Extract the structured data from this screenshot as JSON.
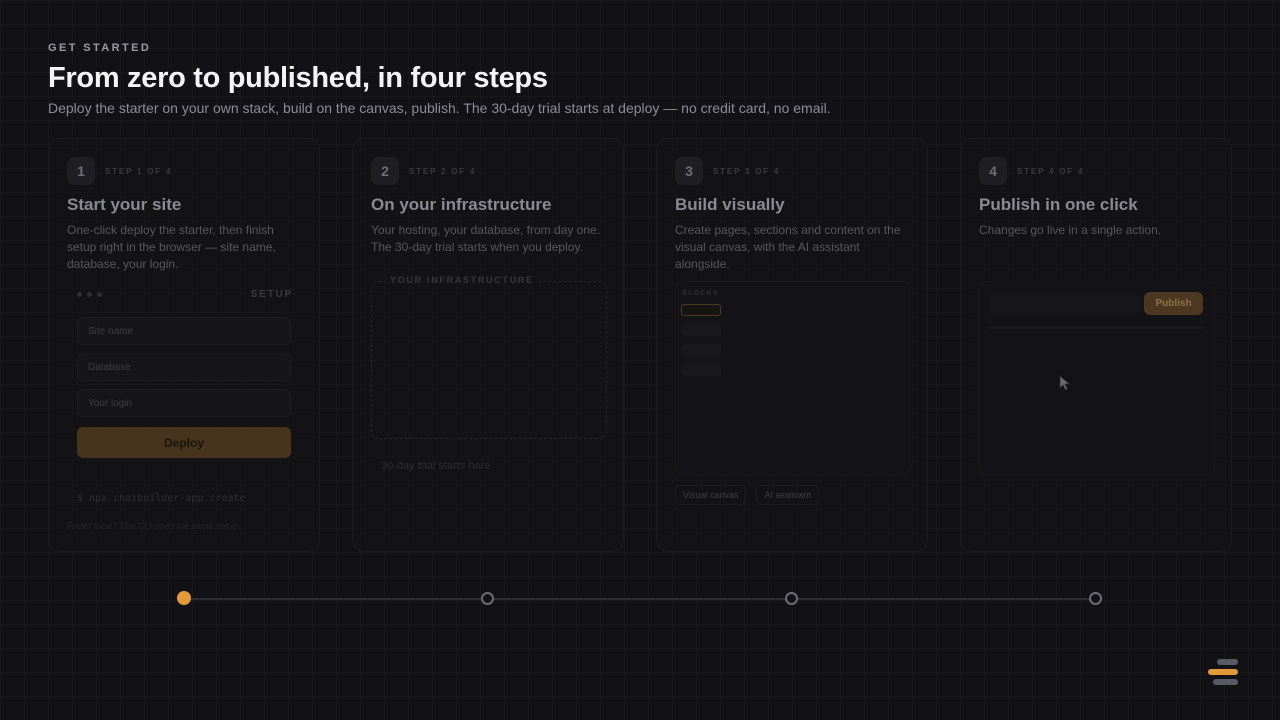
{
  "header": {
    "eyebrow": "GET STARTED",
    "title": "From zero to published, in four steps",
    "subtitle": "Deploy the starter on your own stack, build on the canvas, publish. The 30-day trial starts at deploy — no credit card, no email."
  },
  "steps": [
    {
      "number": "1",
      "label": "STEP 1 OF 4",
      "title": "Start your site",
      "description": "One-click deploy the starter, then finish setup right in the browser — site name, database, your login.",
      "setup_label": "SETUP",
      "fields": [
        "Site name",
        "Database",
        "Your login"
      ],
      "button": "Deploy",
      "cli": "$ npx chaibuilder-app create",
      "cli_note": "Prefer local? The CLI does the same setup."
    },
    {
      "number": "2",
      "label": "STEP 2 OF 4",
      "title": "On your infrastructure",
      "description": "Your hosting, your database, from day one. The 30-day trial starts when you deploy.",
      "box_label": "YOUR INFRASTRUCTURE",
      "note": "30-day trial starts here"
    },
    {
      "number": "3",
      "label": "STEP 3 OF 4",
      "title": "Build visually",
      "description": "Create pages, sections and content on the visual canvas, with the AI assistant alongside.",
      "blocks_label": "BLOCKS",
      "chips": [
        "Visual canvas",
        "AI assistant"
      ]
    },
    {
      "number": "4",
      "label": "STEP 4 OF 4",
      "title": "Publish in one click",
      "description": "Changes go live in a single action.",
      "button": "Publish"
    }
  ],
  "progress": {
    "current_step": 1,
    "total_steps": 4
  },
  "colors": {
    "accent": "#e39a3a",
    "background": "#121216"
  },
  "icons": {
    "cursor": "mouse-pointer-icon",
    "logo": "stacked-bars-logo"
  }
}
